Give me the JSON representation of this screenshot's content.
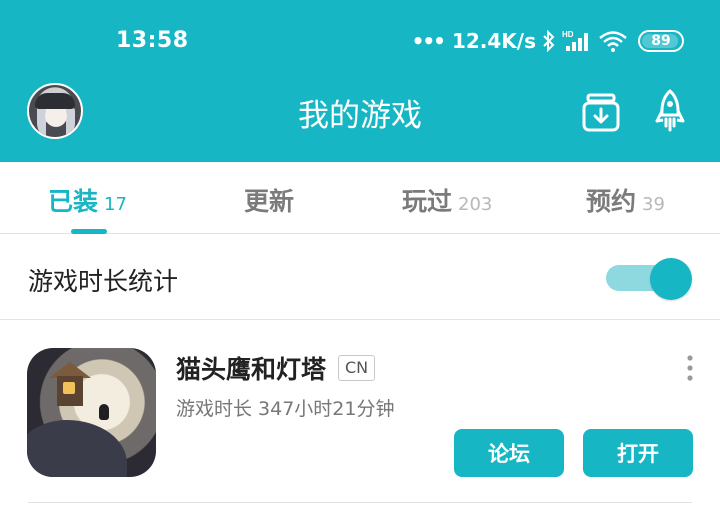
{
  "status_bar": {
    "time": "13:58",
    "network_speed": "12.4K/s",
    "battery": "89",
    "icons": [
      "bluetooth-icon",
      "signal-icon",
      "wifi-icon",
      "battery-icon"
    ]
  },
  "header": {
    "title": "我的游戏",
    "icons": [
      "avatar",
      "download-icon",
      "rocket-icon"
    ]
  },
  "tabs": [
    {
      "label": "已装",
      "count": "17",
      "active": true
    },
    {
      "label": "更新",
      "count": "",
      "active": false
    },
    {
      "label": "玩过",
      "count": "203",
      "active": false
    },
    {
      "label": "预约",
      "count": "39",
      "active": false
    }
  ],
  "playtime_stats": {
    "label": "游戏时长统计",
    "enabled": true
  },
  "games": [
    {
      "name": "猫头鹰和灯塔",
      "region": "CN",
      "playtime": "游戏时长 347小时21分钟",
      "forum_label": "论坛",
      "open_label": "打开"
    }
  ],
  "colors": {
    "accent": "#17b6c4",
    "toggle_track": "#8ed9e0",
    "text_primary": "#222222",
    "text_secondary": "#777777"
  }
}
